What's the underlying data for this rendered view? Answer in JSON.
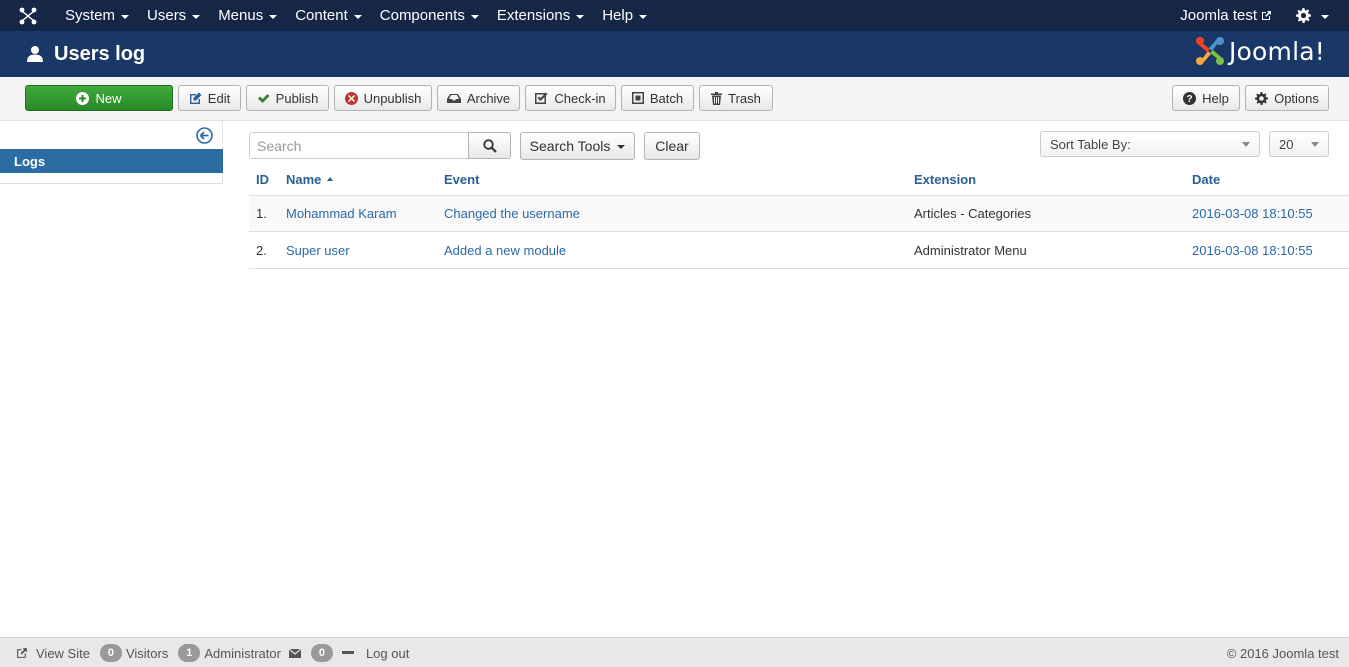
{
  "navbar": {
    "menu": [
      "System",
      "Users",
      "Menus",
      "Content",
      "Components",
      "Extensions",
      "Help"
    ],
    "site_name": "Joomla test"
  },
  "header": {
    "title": "Users log",
    "logo_text": "Joomla!"
  },
  "toolbar": {
    "new": "New",
    "edit": "Edit",
    "publish": "Publish",
    "unpublish": "Unpublish",
    "archive": "Archive",
    "checkin": "Check-in",
    "batch": "Batch",
    "trash": "Trash",
    "help": "Help",
    "options": "Options"
  },
  "sidebar": {
    "items": [
      {
        "label": "Logs"
      }
    ]
  },
  "filters": {
    "search_placeholder": "Search",
    "search_tools": "Search Tools",
    "clear": "Clear",
    "sort_label": "Sort Table By:",
    "limit": "20"
  },
  "table": {
    "columns": [
      "ID",
      "Name",
      "Event",
      "Extension",
      "Date"
    ],
    "rows": [
      {
        "id": "1.",
        "name": "Mohammad Karam",
        "event": "Changed the username",
        "extension": "Articles - Categories",
        "date": "2016-03-08 18:10:55"
      },
      {
        "id": "2.",
        "name": "Super user",
        "event": "Added a new module",
        "extension": "Administrator Menu",
        "date": "2016-03-08 18:10:55"
      }
    ]
  },
  "footer": {
    "view_site": "View Site",
    "visitors_count": "0",
    "visitors": "Visitors",
    "admin_count": "1",
    "administrator": "Administrator",
    "messages_count": "0",
    "logout": "Log out",
    "copyright": "© 2016 Joomla test"
  },
  "colors": {
    "navbar": "#152647",
    "header": "#1a3867",
    "accent": "#2d6ca2",
    "new_button": "#2a8a28"
  }
}
